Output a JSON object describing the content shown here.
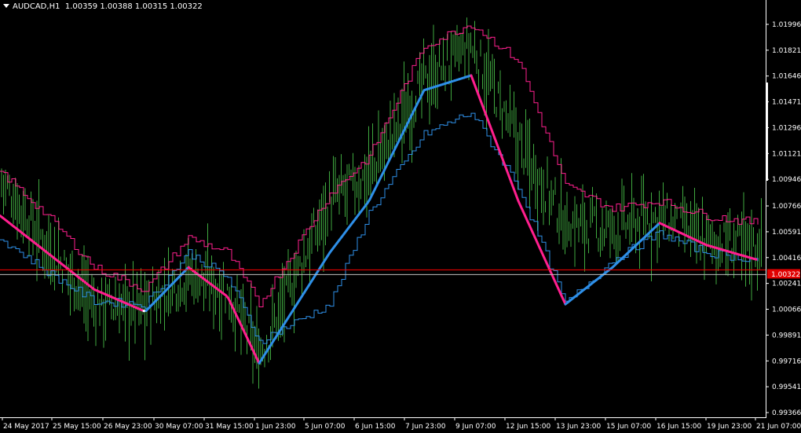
{
  "window": {
    "symbol_title": "AUDCAD,H1",
    "ohlc_readout": "1.00359 1.00388 1.00315 1.00322"
  },
  "price_axis": {
    "labels": [
      "1.01996",
      "1.01821",
      "1.01646",
      "1.01471",
      "1.01296",
      "1.01121",
      "1.00946",
      "1.00766",
      "1.00591",
      "1.00416",
      "1.00241",
      "1.00066",
      "0.99891",
      "0.99716",
      "0.99541",
      "0.99366"
    ],
    "current_price": "1.00322",
    "ask_line_color": "#ff0000",
    "bid_line_color": "#c0c0c0"
  },
  "time_axis": {
    "labels": [
      "24 May 2017",
      "25 May 15:00",
      "26 May 23:00",
      "30 May 07:00",
      "31 May 15:00",
      "1 Jun 23:00",
      "5 Jun 07:00",
      "6 Jun 15:00",
      "7 Jun 23:00",
      "9 Jun 07:00",
      "12 Jun 15:00",
      "13 Jun 23:00",
      "15 Jun 07:00",
      "16 Jun 15:00",
      "19 Jun 23:00",
      "21 Jun 07:00"
    ]
  },
  "colors": {
    "background": "#000000",
    "bars": "#3fa83f",
    "trend_up": "#2e8fe8",
    "trend_down": "#ff1f8e",
    "trend_neutral": "#ffffff",
    "upper_band": "#ff1f8e",
    "lower_band": "#2e8fe8",
    "axis": "#ffffff"
  },
  "chart_data": {
    "type": "line",
    "xlabel": "",
    "ylabel": "",
    "ylim": [
      0.99366,
      1.0215
    ],
    "x": [
      "24 May 2017",
      "25 May 15:00",
      "26 May 23:00",
      "30 May 07:00",
      "31 May 15:00",
      "1 Jun 23:00",
      "5 Jun 07:00",
      "6 Jun 15:00",
      "7 Jun 23:00",
      "9 Jun 07:00",
      "12 Jun 15:00",
      "13 Jun 23:00",
      "15 Jun 07:00",
      "16 Jun 15:00",
      "19 Jun 23:00",
      "21 Jun 07:00"
    ],
    "series": [
      {
        "values": [
          1.0095,
          1.005,
          1.001,
          1.0007,
          1.0031,
          1.0018,
          0.9975,
          1.008,
          1.0098,
          1.016,
          1.0185,
          1.012,
          1.0065,
          1.006,
          1.007,
          1.0052,
          1.005
        ]
      },
      {
        "values": [
          1.0055,
          1.0032,
          1.0012,
          1.001,
          1.0045,
          1.0028,
          0.9985,
          1.001,
          1.0072,
          1.0125,
          1.014,
          1.009,
          1.001,
          1.004,
          1.0058,
          1.0045,
          1.004
        ]
      },
      {
        "values": [
          1.01,
          1.007,
          1.0035,
          1.002,
          1.0055,
          1.0045,
          1.001,
          1.0085,
          1.011,
          1.0185,
          1.02,
          1.0175,
          1.009,
          1.0075,
          1.008,
          1.007,
          1.0065
        ]
      },
      {
        "values": [
          1.007,
          1.0045,
          1.002,
          1.0005,
          1.0035,
          1.0015,
          0.997,
          1.0045,
          1.008,
          1.0155,
          1.0165,
          1.008,
          1.001,
          1.0035,
          1.0065,
          1.005,
          1.004
        ]
      }
    ]
  }
}
